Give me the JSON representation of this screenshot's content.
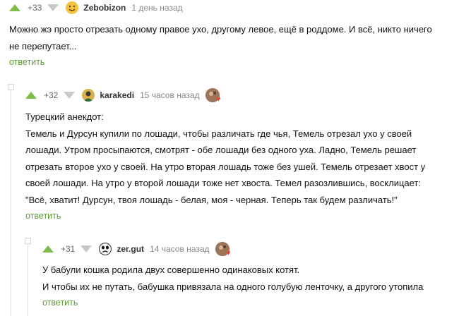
{
  "comments": [
    {
      "rating": "+33",
      "username": "Zebobizon",
      "time": "1 день назад",
      "avatar_icon": "smiling-face-avatar",
      "text": [
        "Можно жэ просто отрезать одному правое ухо, другому левое, ещё в роддоме. И всё, никто ничего",
        "не перепутает..."
      ],
      "reply_label": "ответить"
    },
    {
      "rating": "+32",
      "username": "karakedi",
      "time": "15 часов назад",
      "avatar_icon": "person-photo-avatar",
      "award_icon": "award-heart-icon",
      "text": [
        "Турецкий анекдот:",
        "Темель и Дурсун купили по лошади, чтобы различать где чья, Темель отрезал ухо у своей",
        "лошади. Утром просыпаются, смотрят - обе лошади без одного уха. Ладно, Темель решает",
        "отрезать второе ухо у своей. На утро вторая лошадь тоже без ушей. Темель отрезает хвост у",
        "своей лошади. На утро у второй лошади тоже нет хвоста. Темел разозлившись, восклицает:",
        "\"Всё, хватит! Дурсун, твоя лошадь - белая, моя - черная. Теперь так будем различать!\""
      ],
      "reply_label": "ответить"
    },
    {
      "rating": "+31",
      "username": "zer.gut",
      "time": "14 часов назад",
      "avatar_icon": "sad-face-avatar",
      "award_icon": "award-heart-icon",
      "text": [
        "У бабули кошка родила двух совершенно одинаковых котят.",
        "И чтобы их не путать, бабушка привязала на одного голубую ленточку, а другого утопила"
      ],
      "reply_label": "ответить"
    }
  ],
  "colors": {
    "upvote": "#7fbd4a",
    "downvote": "#c8c8c8",
    "reply_link": "#5f9a3a"
  }
}
